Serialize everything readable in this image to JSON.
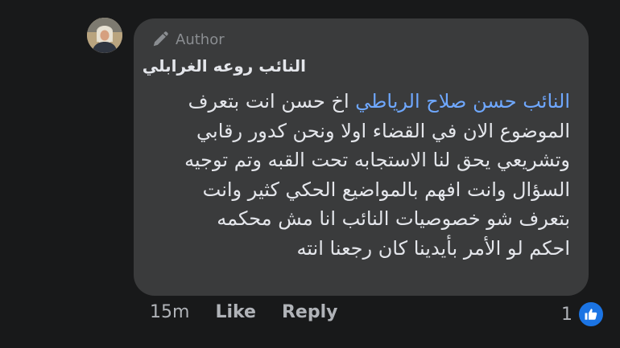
{
  "comment": {
    "badge_label": "Author",
    "author_name": "النائب روعه الغرابلي",
    "mention": "النائب حسن صلاح الرياطي",
    "first_line_rest": " اخ حسن انت بتعرف",
    "lines": [
      "الموضوع الان في القضاء اولا ونحن كدور رقابي",
      "وتشريعي يحق لنا الاستجابه تحت القبه وتم توجيه",
      "السؤال وانت افهم بالمواضيع الحكي كثير وانت",
      "بتعرف شو خصوصيات النائب انا مش محكمه",
      "احكم لو الأمر بأيدينا كان رجعنا انته"
    ],
    "mention_color": "#6fa8ff"
  },
  "actions": {
    "time": "15m",
    "like_label": "Like",
    "reply_label": "Reply",
    "reaction_count": "1"
  },
  "icons": {
    "badge_icon": "pencil-icon",
    "reaction_icon": "thumbs-up-icon",
    "like_color": "#1b74e4"
  }
}
